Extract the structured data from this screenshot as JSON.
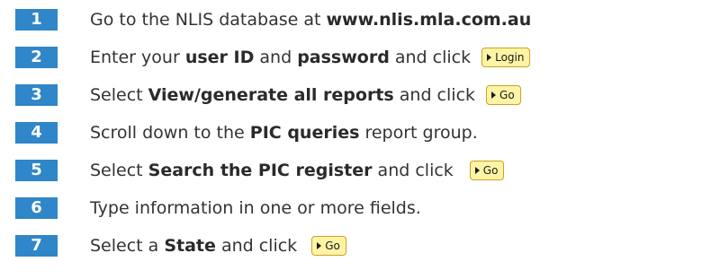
{
  "steps": [
    {
      "number": "1",
      "parts": [
        "Go to the NLIS database at ",
        "www.nlis.mla.com.au"
      ]
    },
    {
      "number": "2",
      "parts": [
        "Enter your ",
        "user ID",
        " and ",
        "password",
        " and click"
      ],
      "button": "Login"
    },
    {
      "number": "3",
      "parts": [
        "Select ",
        "View/generate all reports",
        " and click"
      ],
      "button": "Go"
    },
    {
      "number": "4",
      "parts": [
        "Scroll down to the ",
        "PIC queries",
        " report group."
      ]
    },
    {
      "number": "5",
      "parts": [
        "Select ",
        "Search the PIC register",
        " and click"
      ],
      "button": "Go"
    },
    {
      "number": "6",
      "parts": [
        "Type information in one or more fields."
      ]
    },
    {
      "number": "7",
      "parts": [
        "Select a ",
        "State",
        " and click"
      ],
      "button": "Go"
    }
  ],
  "colors": {
    "step_badge": "#2f86c8",
    "button_bg": "#fff4a6",
    "button_border": "#c9a321"
  },
  "icons": {
    "button": "play-triangle-icon"
  }
}
